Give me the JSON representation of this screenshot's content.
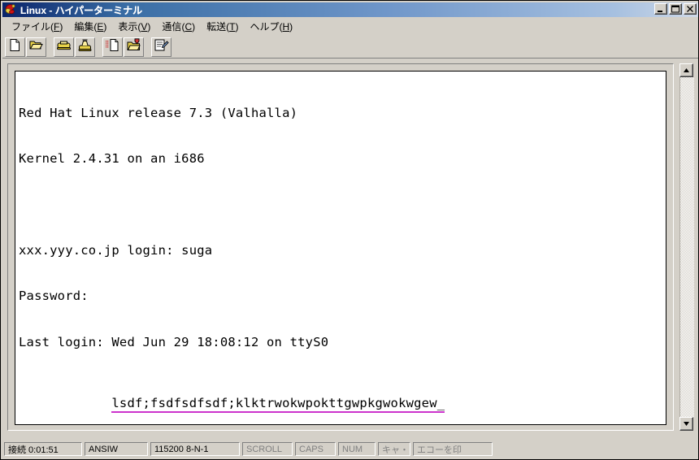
{
  "window": {
    "title": "Linux - ハイパーターミナル",
    "icon": "hyperterminal-icon",
    "minimize_label": "_",
    "maximize_label": "□",
    "close_label": "✕"
  },
  "menu": {
    "items": [
      {
        "label": "ファイル",
        "mnemonic": "F",
        "name": "menu-file"
      },
      {
        "label": "編集",
        "mnemonic": "E",
        "name": "menu-edit"
      },
      {
        "label": "表示",
        "mnemonic": "V",
        "name": "menu-view"
      },
      {
        "label": "通信",
        "mnemonic": "C",
        "name": "menu-call"
      },
      {
        "label": "転送",
        "mnemonic": "T",
        "name": "menu-transfer"
      },
      {
        "label": "ヘルプ",
        "mnemonic": "H",
        "name": "menu-help"
      }
    ]
  },
  "toolbar": {
    "buttons": [
      {
        "name": "new-connection-icon",
        "tip": "新しい接続"
      },
      {
        "name": "open-folder-icon",
        "tip": "開く"
      },
      {
        "name": "dial-phone-icon",
        "tip": "電話をかける"
      },
      {
        "name": "hangup-phone-icon",
        "tip": "切断"
      },
      {
        "name": "send-file-icon",
        "tip": "送信"
      },
      {
        "name": "receive-file-icon",
        "tip": "受信"
      },
      {
        "name": "properties-icon",
        "tip": "プロパティ"
      }
    ]
  },
  "terminal": {
    "lines": [
      {
        "text": "Red Hat Linux release 7.3 (Valhalla)",
        "underline": false
      },
      {
        "text": "Kernel 2.4.31 on an i686",
        "underline": false
      },
      {
        "text": "",
        "underline": false
      },
      {
        "text": "xxx.yyy.co.jp login: suga",
        "underline": false
      },
      {
        "text": "Password:",
        "underline": false
      },
      {
        "text": "Last login: Wed Jun 29 18:08:12 on ttyS0",
        "underline": false
      },
      {
        "text": "lsdf;fsdfsdfsdf;klktrwokwpokttgwpkgwokwgew_",
        "underline": true
      }
    ],
    "underline_color": "#cc33cc",
    "text_color": "#000000",
    "background_color": "#ffffff"
  },
  "scrollbar": {
    "up_arrow": "▲",
    "down_arrow": "▼"
  },
  "status": {
    "connected": "接続 0:01:51",
    "emulation": "ANSIW",
    "line_settings": "115200 8-N-1",
    "scroll": "SCROLL",
    "caps": "CAPS",
    "num": "NUM",
    "capture": "キャ・",
    "print_echo": "エコーを印"
  },
  "colors": {
    "title_bar_start": "#0a246a",
    "title_bar_end": "#cfd9e8",
    "window_face": "#d4d0c8",
    "accent_underline": "#cc33cc"
  }
}
